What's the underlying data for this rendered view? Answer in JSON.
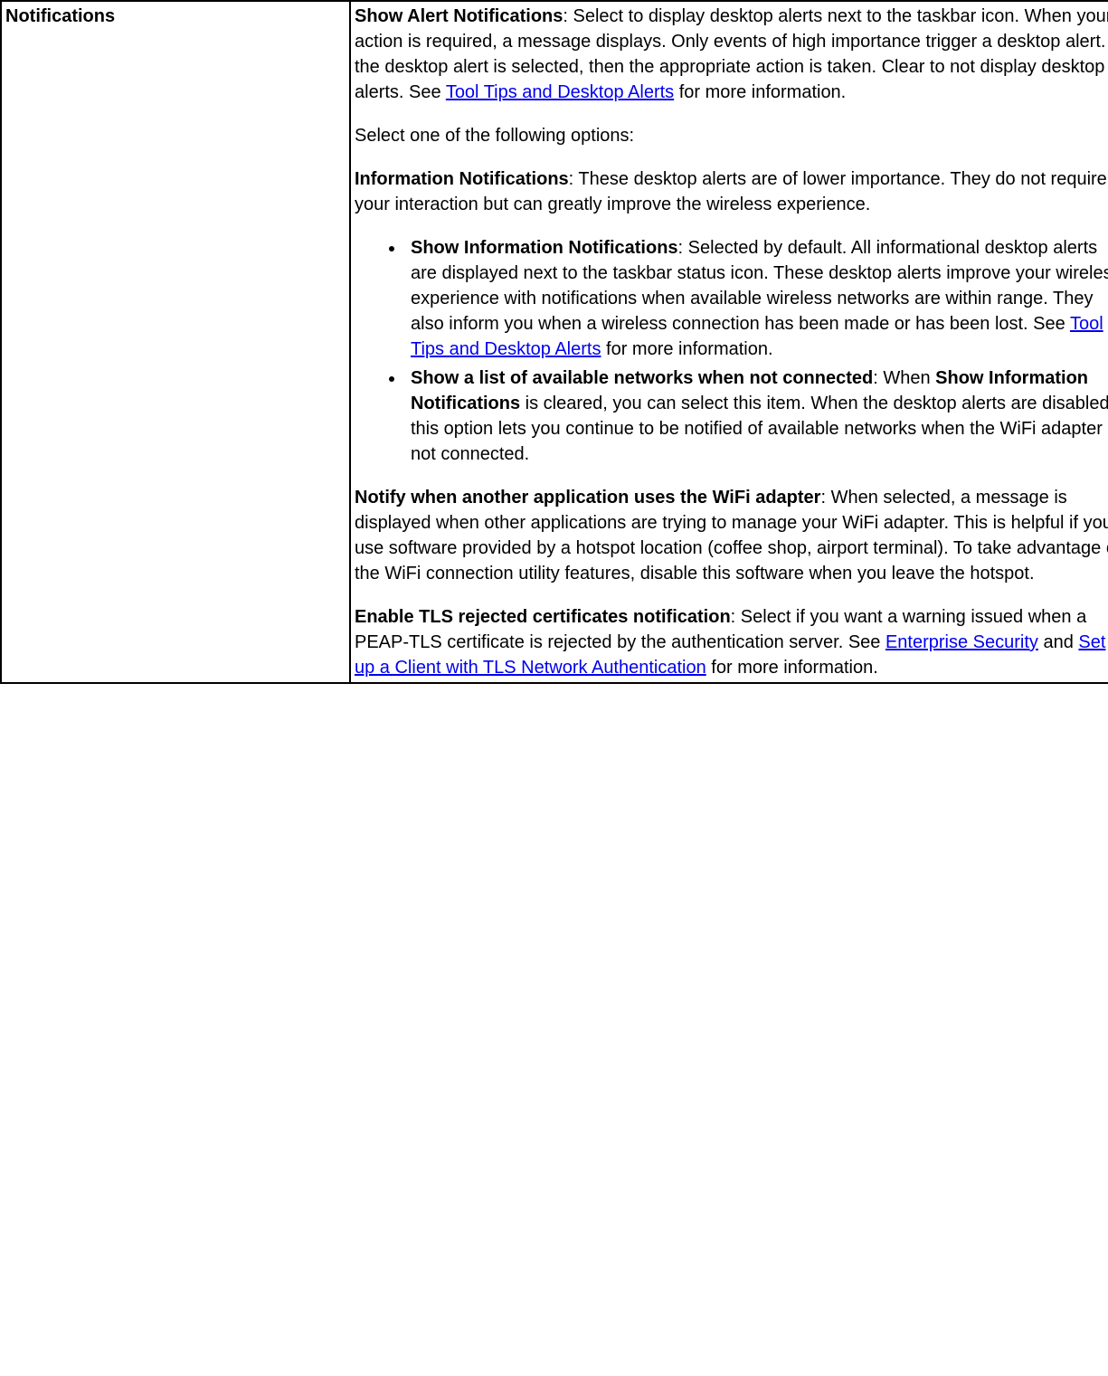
{
  "leftHeader": "Notifications",
  "p1": {
    "bold": "Show Alert Notifications",
    "text1": ": Select to display desktop alerts next to the taskbar icon. When your action is required, a message displays. Only events of high importance trigger a desktop alert. If the desktop alert is selected, then the appropriate action is taken. Clear to not display desktop alerts. See ",
    "link": "Tool Tips and Desktop Alerts",
    "text2": " for more information."
  },
  "p2": "Select one of the following options:",
  "p3": {
    "bold": "Information Notifications",
    "text": ": These desktop alerts are of lower importance. They do not require your interaction but can greatly improve the wireless experience."
  },
  "li1": {
    "bold": "Show Information Notifications",
    "text1": ": Selected by default. All informational desktop alerts are displayed next to the taskbar status icon. These desktop alerts improve your wireless experience with notifications when available wireless networks are within range. They also inform you when a wireless connection has been made or has been lost. See ",
    "link": "Tool Tips and Desktop Alerts",
    "text2": " for more information."
  },
  "li2": {
    "bold1": "Show a list of available networks when not connected",
    "text1": ": When ",
    "bold2": "Show Information Notifications",
    "text2": " is cleared, you can select this item. When the desktop alerts are disabled, this option lets you continue to be notified of available networks when the WiFi adapter is not connected."
  },
  "p4": {
    "bold": "Notify when another application uses the WiFi adapter",
    "text": ": When selected, a message is displayed when other applications are trying to manage your WiFi adapter. This is helpful if you use software provided by a hotspot location (coffee shop, airport terminal). To take advantage of the WiFi connection utility features, disable this software when you leave the hotspot."
  },
  "p5": {
    "bold": "Enable TLS rejected certificates notification",
    "text1": ": Select if you want a warning issued when a PEAP-TLS certificate is rejected by the authentication server. See ",
    "link1": "Enterprise Security",
    "mid": " and ",
    "link2": "Set up a Client with TLS Network Authentication",
    "text2": " for more information."
  }
}
